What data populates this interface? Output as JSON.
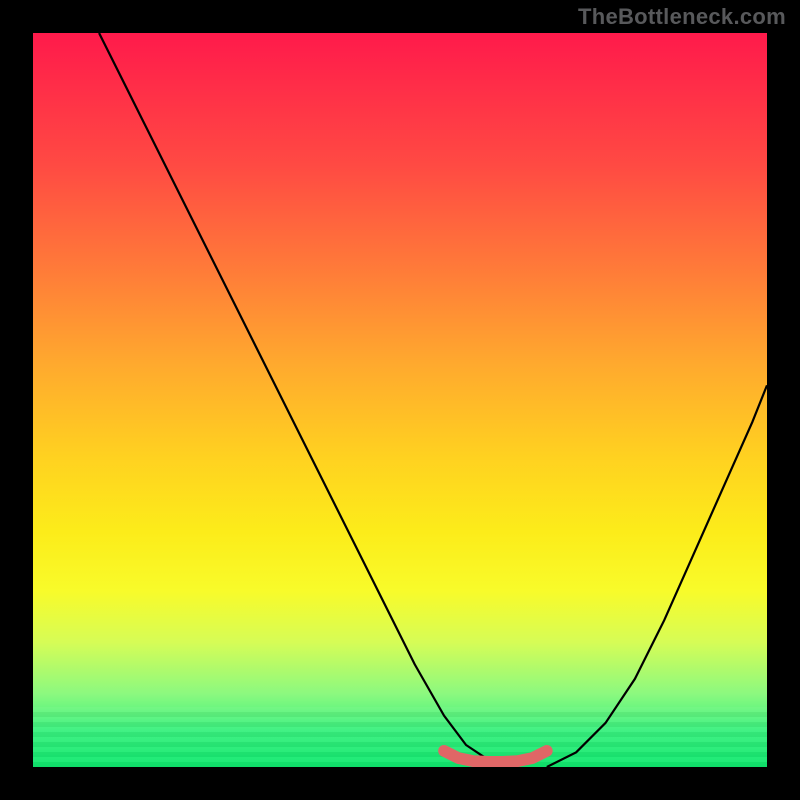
{
  "watermark": "TheBottleneck.com",
  "chart_data": {
    "type": "line",
    "title": "",
    "xlabel": "",
    "ylabel": "",
    "xlim": [
      0,
      100
    ],
    "ylim": [
      0,
      100
    ],
    "series": [
      {
        "name": "curve-left",
        "x": [
          9,
          15,
          22,
          30,
          38,
          46,
          52,
          56,
          59,
          62,
          64
        ],
        "values": [
          100,
          88,
          74,
          58,
          42,
          26,
          14,
          7,
          3,
          1,
          0
        ]
      },
      {
        "name": "curve-right",
        "x": [
          70,
          74,
          78,
          82,
          86,
          90,
          94,
          98,
          100
        ],
        "values": [
          0,
          2,
          6,
          12,
          20,
          29,
          38,
          47,
          52
        ]
      },
      {
        "name": "flat-marker",
        "x": [
          56,
          58,
          60,
          62,
          64,
          66,
          68,
          70
        ],
        "values": [
          2.2,
          1.2,
          0.8,
          0.7,
          0.7,
          0.8,
          1.2,
          2.2
        ]
      }
    ],
    "gradient_stops": [
      {
        "pos": 0,
        "color": "#ff1a4b"
      },
      {
        "pos": 18,
        "color": "#ff4a43"
      },
      {
        "pos": 32,
        "color": "#ff7a39"
      },
      {
        "pos": 45,
        "color": "#ffa92e"
      },
      {
        "pos": 58,
        "color": "#ffd220"
      },
      {
        "pos": 68,
        "color": "#fcec1a"
      },
      {
        "pos": 76,
        "color": "#f8fb2a"
      },
      {
        "pos": 83,
        "color": "#d6fc56"
      },
      {
        "pos": 90,
        "color": "#8cf97f"
      },
      {
        "pos": 95,
        "color": "#3af17f"
      },
      {
        "pos": 100,
        "color": "#0fe96e"
      }
    ],
    "colors": {
      "curve": "#000000",
      "marker": "#e06666",
      "frame": "#000000"
    }
  }
}
